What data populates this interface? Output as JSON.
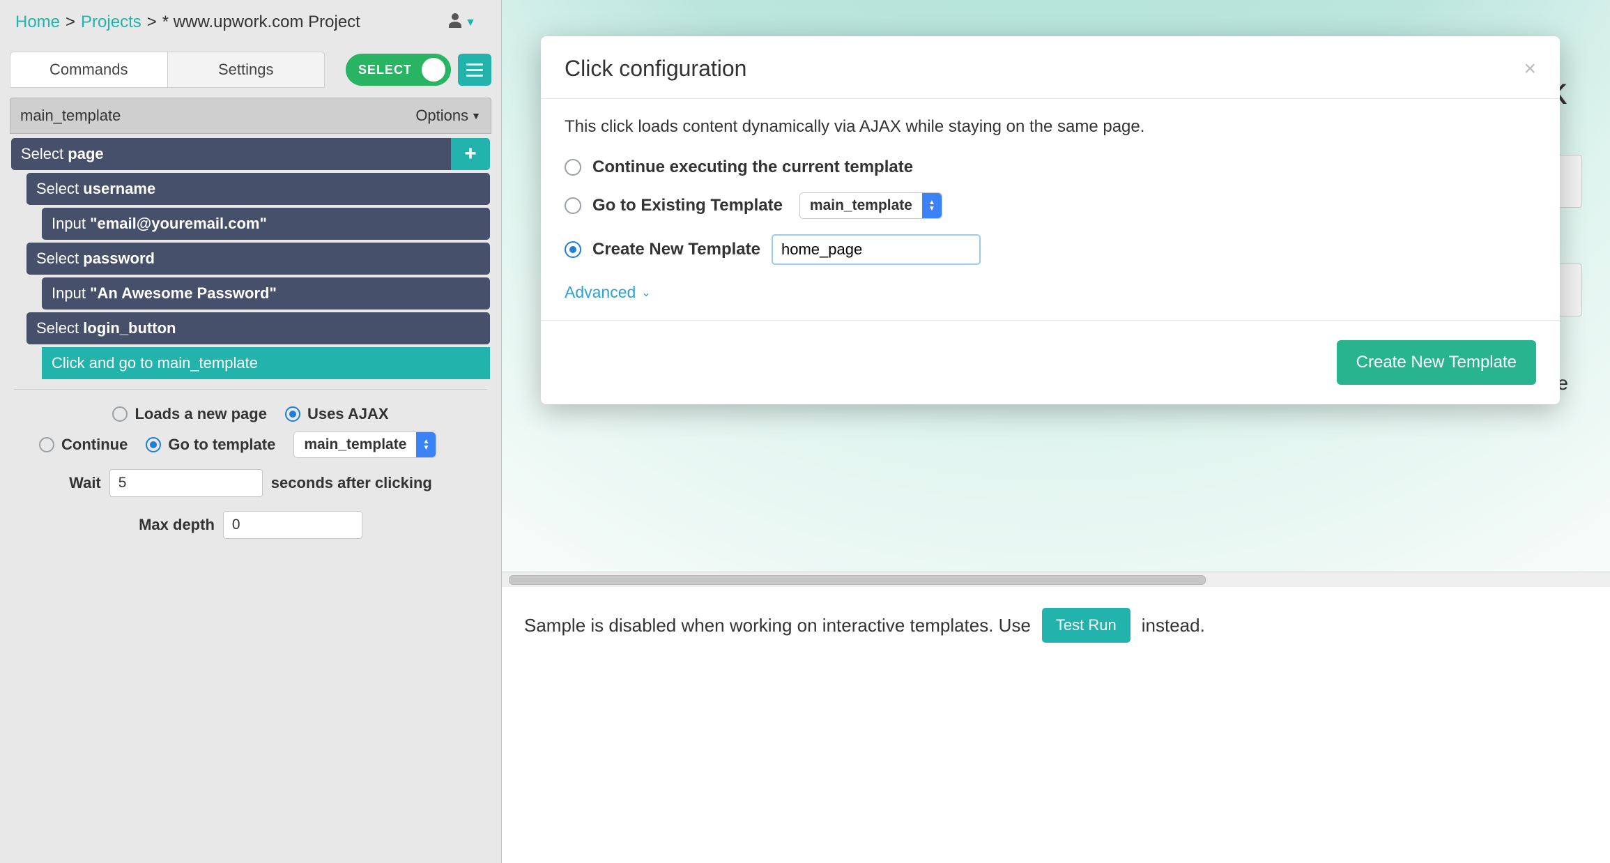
{
  "breadcrumb": {
    "home": "Home",
    "projects": "Projects",
    "current": "* www.upwork.com Project"
  },
  "tabs": {
    "commands": "Commands",
    "settings": "Settings"
  },
  "select_toggle": "SELECT",
  "template": {
    "name": "main_template",
    "options_label": "Options"
  },
  "cmds": {
    "select": "Select",
    "page": "page",
    "username": "username",
    "input": "Input",
    "email_q": "\"email@youremail.com\"",
    "password": "password",
    "pw_q": "\"An Awesome Password\"",
    "login_button": "login_button",
    "click_go": "Click and go to main_template"
  },
  "clickopts": {
    "loads": "Loads a new page",
    "ajax": "Uses AJAX",
    "cont": "Continue",
    "goto": "Go to template",
    "goto_val": "main_template",
    "wait_l": "Wait",
    "wait_v": "5",
    "wait_r": "seconds after clicking",
    "depth_l": "Max depth",
    "depth_v": "0"
  },
  "modal": {
    "title": "Click configuration",
    "desc": "This click loads content dynamically via AJAX while staying on the same page.",
    "opt1": "Continue executing the current template",
    "opt2": "Go to Existing Template",
    "opt2_val": "main_template",
    "opt3": "Create New Template",
    "opt3_val": "home_page",
    "advanced": "Advanced",
    "submit": "Create New Template"
  },
  "bg": {
    "title_tail": "work",
    "hint_tail": "t time"
  },
  "sample": {
    "pre": "Sample is disabled when working on interactive templates. Use",
    "btn": "Test Run",
    "post": "instead."
  }
}
